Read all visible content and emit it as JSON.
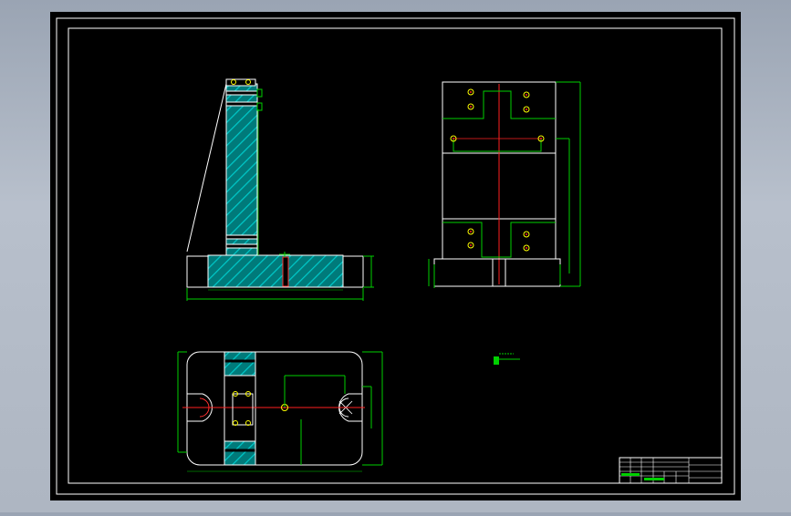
{
  "drawing": {
    "title_block": {
      "rows": 5,
      "text": ""
    },
    "views": [
      "side-section-view",
      "top-view",
      "plan-section-view"
    ],
    "colors": {
      "background": "#000000",
      "frame": "#ffffff",
      "outline": "#ffffff",
      "dimension": "#00d000",
      "centerline": "#ff2020",
      "hatch": "#00b0b0",
      "hole": "#ffff00"
    }
  }
}
